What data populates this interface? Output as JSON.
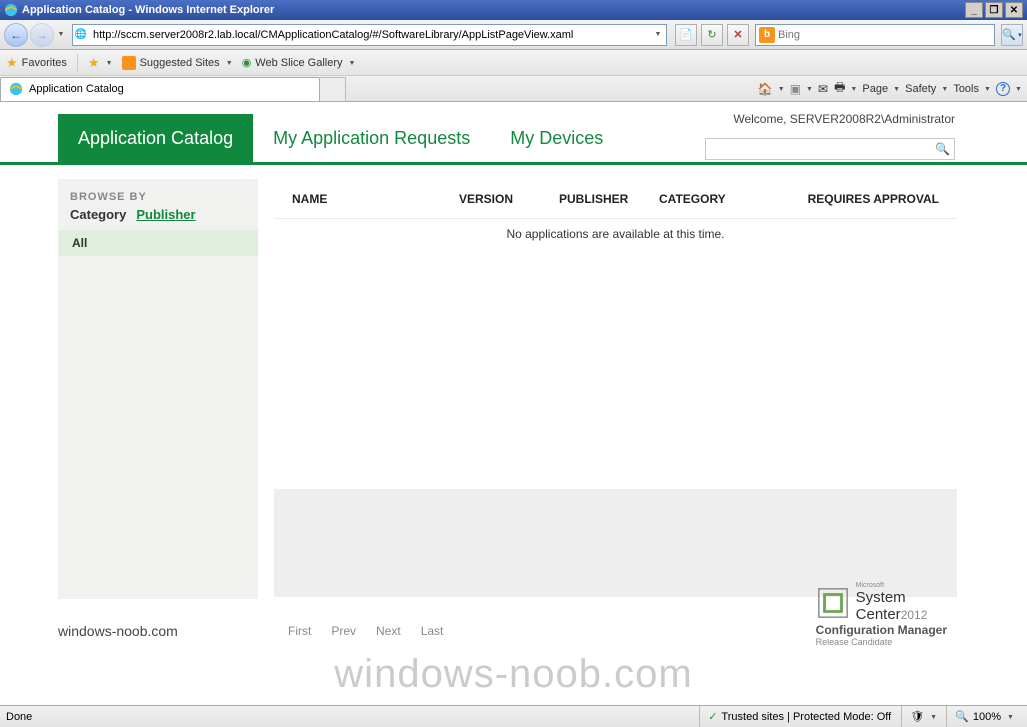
{
  "window": {
    "title": "Application Catalog - Windows Internet Explorer"
  },
  "addressbar": {
    "url": "http://sccm.server2008r2.lab.local/CMApplicationCatalog/#/SoftwareLibrary/AppListPageView.xaml"
  },
  "search": {
    "engine": "Bing"
  },
  "favbar": {
    "favorites": "Favorites",
    "suggested": "Suggested Sites",
    "webslice": "Web Slice Gallery"
  },
  "tab": {
    "title": "Application Catalog"
  },
  "cmdbar": {
    "page": "Page",
    "safety": "Safety",
    "tools": "Tools"
  },
  "app": {
    "welcome": "Welcome, SERVER2008R2\\Administrator",
    "tabs": {
      "catalog": "Application Catalog",
      "requests": "My Application Requests",
      "devices": "My Devices"
    },
    "sidebar": {
      "browseby": "BROWSE BY",
      "category": "Category",
      "publisher": "Publisher",
      "all": "All"
    },
    "columns": {
      "name": "NAME",
      "version": "VERSION",
      "publisher": "PUBLISHER",
      "category": "CATEGORY",
      "requires": "REQUIRES APPROVAL"
    },
    "empty": "No applications are available at this time.",
    "brand": "windows-noob.com",
    "pager": {
      "first": "First",
      "prev": "Prev",
      "next": "Next",
      "last": "Last"
    },
    "product": {
      "ms": "Microsoft",
      "sc1": "System Center",
      "year": "2012",
      "cm": "Configuration Manager",
      "rc": "Release Candidate"
    }
  },
  "statusbar": {
    "done": "Done",
    "zone": "Trusted sites | Protected Mode: Off",
    "zoom": "100%"
  },
  "watermark": "windows-noob.com"
}
